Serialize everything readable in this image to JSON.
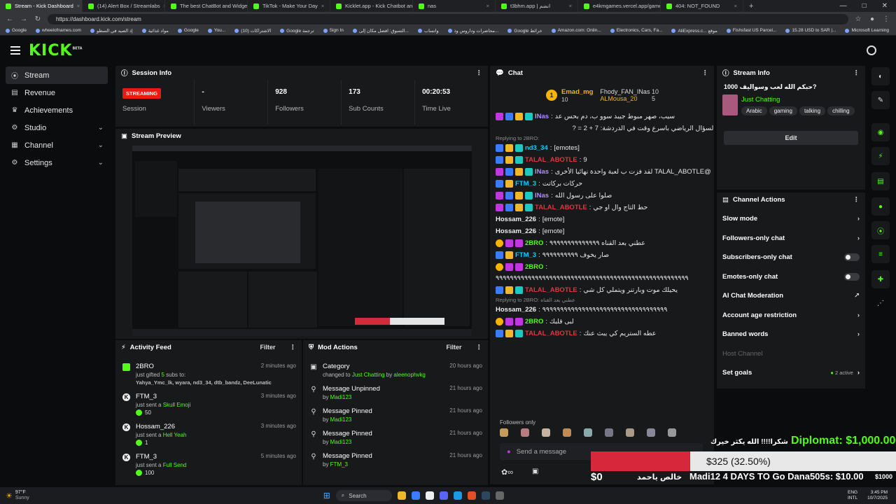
{
  "browser": {
    "tabs": [
      {
        "title": "Stream - Kick Dashboard",
        "active": true
      },
      {
        "title": "(14) Alert Box / Streamlabs"
      },
      {
        "title": "The best ChatBot and Widgets fo..."
      },
      {
        "title": "TikTok - Make Your Day"
      },
      {
        "title": "Kicklet.app - Kick Chatbot and C..."
      },
      {
        "title": "nas"
      },
      {
        "title": "t3bhm.app | انضم"
      },
      {
        "title": "e4kmgames.vercel.app/games/..."
      },
      {
        "title": "404: NOT_FOUND"
      }
    ],
    "url": "https://dashboard.kick.com/stream",
    "bookmarks": [
      "Google",
      "wheelofnames.com",
      "إذ الصيد في السطو",
      "مواد غذائية",
      "Google",
      "You...",
      "(10) الاشتراكات",
      "Google ترجمة",
      "Sign In",
      "التسوق: افضل مكان إلى...",
      "واتساب",
      "محاضرات وداروس وذ...",
      "Google خرائط",
      "Amazon.com: Onlin...",
      "Electronics, Cars, Fa...",
      "AliExpress.c... موقع",
      "Fishsfast US Parcel...",
      "15.28 USD to SAR |...",
      "Microsoft Learning",
      "الخطيب"
    ]
  },
  "brand": {
    "logo": "KICK",
    "beta": "BETA",
    "accent": "#53fc18"
  },
  "nav": [
    {
      "label": "Stream",
      "icon": "broadcast-icon",
      "active": true
    },
    {
      "label": "Revenue",
      "icon": "revenue-icon"
    },
    {
      "label": "Achievements",
      "icon": "trophy-icon"
    },
    {
      "label": "Studio",
      "icon": "gear-icon",
      "chevron": true
    },
    {
      "label": "Channel",
      "icon": "grid-icon",
      "chevron": true
    },
    {
      "label": "Settings",
      "icon": "settings-icon",
      "chevron": true
    }
  ],
  "session": {
    "title": "Session Info",
    "status": "STREAMING",
    "status_label": "Session",
    "viewers": "-",
    "viewers_label": "Viewers",
    "followers": "928",
    "followers_label": "Followers",
    "subs": "173",
    "subs_label": "Sub Counts",
    "time": "00:20:53",
    "time_label": "Time Live"
  },
  "preview": {
    "title": "Stream Preview"
  },
  "activity": {
    "title": "Activity Feed",
    "filter": "Filter",
    "items": [
      {
        "user": "2BRO",
        "time": "2 minutes ago",
        "pre": "just gifted ",
        "hl": "5",
        "post": " subs to:",
        "extra": "Yahya_Ymc_lk, wyara, nd3_34, dtb_bandz, DeeLunatic",
        "icon": "gift-icon"
      },
      {
        "user": "FTM_3",
        "time": "3 minutes ago",
        "pre": "just sent a ",
        "hl": "Skull Emoji",
        "amount": "50",
        "icon": "kick-coin-icon"
      },
      {
        "user": "Hossam_226",
        "time": "3 minutes ago",
        "pre": "just sent a ",
        "hl": "Hell Yeah",
        "amount": "1",
        "icon": "kick-coin-icon"
      },
      {
        "user": "FTM_3",
        "time": "5 minutes ago",
        "pre": "just sent a ",
        "hl": "Full Send",
        "amount": "100",
        "icon": "kick-coin-icon"
      }
    ]
  },
  "mod": {
    "title": "Mod Actions",
    "filter": "Filter",
    "items": [
      {
        "action": "Category",
        "time": "20 hours ago",
        "pre": "changed to ",
        "hl": "Just Chatting",
        "mid": " by ",
        "by": "aleenophvkg",
        "icon": "category-icon"
      },
      {
        "action": "Message Unpinned",
        "time": "21 hours ago",
        "mid": "by ",
        "by": "Madi123",
        "icon": "pin-icon"
      },
      {
        "action": "Message Pinned",
        "time": "21 hours ago",
        "mid": "by ",
        "by": "Madi123",
        "icon": "pin-icon"
      },
      {
        "action": "Message Pinned",
        "time": "21 hours ago",
        "mid": "by ",
        "by": "Madi123",
        "icon": "pin-icon"
      },
      {
        "action": "Message Pinned",
        "time": "21 hours ago",
        "mid": "by ",
        "by": "FTM_3",
        "icon": "pin-icon"
      }
    ]
  },
  "chat": {
    "title": "Chat",
    "leaders": [
      {
        "name": "Emad_mg",
        "rank": "1",
        "count": "10"
      },
      {
        "name": "Fhody_FAN_INas",
        "count": "10"
      },
      {
        "name": "ALMousa_20",
        "count": "5"
      }
    ],
    "lines": [
      {
        "user": "INas",
        "color": "vi",
        "badges": [
          "m",
          "p",
          "g",
          "t"
        ],
        "text": "سيب، صهر مبوط جيبد سوو ب، دم بحس عد"
      },
      {
        "text": "السؤال الرياضي باسرع وقت في الدردشة: 7 + 2 = ?",
        "plain": true
      },
      {
        "reply": "Replying to 2BRO:"
      },
      {
        "user": "nd3_34",
        "color": "cy",
        "badges": [
          "p",
          "g",
          "t"
        ],
        "text": "[emotes]"
      },
      {
        "user": "TALAL_ABOTLE",
        "color": "red",
        "badges": [
          "p",
          "g",
          "t"
        ],
        "text": "9"
      },
      {
        "user": "INas",
        "color": "vi",
        "badges": [
          "m",
          "p",
          "g",
          "t"
        ],
        "text": "@TALAL_ABOTLE لقد فزت ب لعبة واحدة نهائيا الأخرى"
      },
      {
        "user": "FTM_3",
        "color": "cy",
        "badges": [
          "p",
          "g"
        ],
        "text": "حركات بركاتت"
      },
      {
        "user": "INas",
        "color": "vi",
        "badges": [
          "m",
          "p",
          "g",
          "t"
        ],
        "text": "صلوا على رسول الله"
      },
      {
        "user": "TALAL_ABOTLE",
        "color": "red",
        "badges": [
          "m",
          "p",
          "g",
          "t"
        ],
        "text": "حط التاج وال او جي"
      },
      {
        "user": "Hossam_226",
        "color": "wh",
        "badges": [],
        "text": "[emote]"
      },
      {
        "user": "Hossam_226",
        "color": "wh",
        "badges": [],
        "text": "[emote]"
      },
      {
        "user": "2BRO",
        "color": "gr",
        "badges": [
          "y",
          "m",
          "m"
        ],
        "text": "عطني بعد القناه ٩٩٩٩٩٩٩٩٩٩٩٩٩٩"
      },
      {
        "user": "FTM_3",
        "color": "cy",
        "badges": [
          "p",
          "g"
        ],
        "text": "صار يخوف ٩٩٩٩٩٩٩٩٩٩"
      },
      {
        "user": "2BRO",
        "color": "gr",
        "badges": [
          "y",
          "m",
          "m"
        ],
        "text": "٩٩٩٩٩٩٩٩٩٩٩٩٩٩٩٩٩٩٩٩٩٩٩٩٩٩٩٩٩٩٩٩٩٩٩٩٩٩٩٩٩٩٩٩٩٩٩٩٩٩٩٩٩٩"
      },
      {
        "user": "TALAL_ABOTLE",
        "color": "red",
        "badges": [
          "p",
          "g",
          "t"
        ],
        "text": "يحيلك موت وبارتنر ويتملي كل شي"
      },
      {
        "reply": "Replying to 2BRO: عطني بعد القناه"
      },
      {
        "user": "Hossam_226",
        "color": "wh",
        "badges": [],
        "text": "٩٩٩٩٩٩٩٩٩٩٩٩٩٩٩٩٩٩٩٩٩٩٩٩٩٩٩٩٩٩٩٩٩٩٩"
      },
      {
        "user": "2BRO",
        "color": "gr",
        "badges": [
          "y",
          "m",
          "m"
        ],
        "text": "لبى قلبك"
      },
      {
        "user": "TALAL_ABOTLE",
        "color": "red",
        "badges": [
          "p",
          "g",
          "t"
        ],
        "text": "عطه الستريم كي يبث عنك"
      }
    ],
    "followers_only": "Followers only",
    "input_placeholder": "Send a message"
  },
  "stream_info": {
    "title": "Stream Info",
    "stream_title": "حبكم الله لعب وسواليف 1000?",
    "category": "Just Chatting",
    "tags": [
      "Arabic",
      "gaming",
      "talking",
      "chilling"
    ],
    "edit": "Edit"
  },
  "channel_actions": {
    "title": "Channel Actions",
    "items": [
      {
        "label": "Slow mode",
        "type": "chevron"
      },
      {
        "label": "Followers-only chat",
        "type": "chevron"
      },
      {
        "label": "Subscribers-only chat",
        "type": "toggle"
      },
      {
        "label": "Emotes-only chat",
        "type": "toggle"
      },
      {
        "label": "AI Chat Moderation",
        "type": "external"
      },
      {
        "label": "Account age restriction",
        "type": "chevron"
      },
      {
        "label": "Banned words",
        "type": "chevron"
      },
      {
        "label": "Host Channel",
        "type": "disabled"
      },
      {
        "label": "Set goals",
        "type": "chevron",
        "extra": "2 active"
      }
    ]
  },
  "overlay": {
    "diplomat": "Diplomat: $1,000.00",
    "thanks": "شكرا!!!! الله يكثر خيرك",
    "progress_text": "$325 (32.50%)",
    "progress_fraction": 0.325,
    "zero": "$0",
    "name_ar": "خالص ياحمد",
    "ticker": "Madi12 4 DAYS TO Go  Dana505s: $10.00",
    "right_amount": "$1000"
  },
  "taskbar": {
    "weather_temp": "97°F",
    "weather_desc": "Sunny",
    "search": "Search",
    "lang": "ENG",
    "lang2": "INTL",
    "time": "3:45 PM",
    "date": "10/7/2025"
  }
}
